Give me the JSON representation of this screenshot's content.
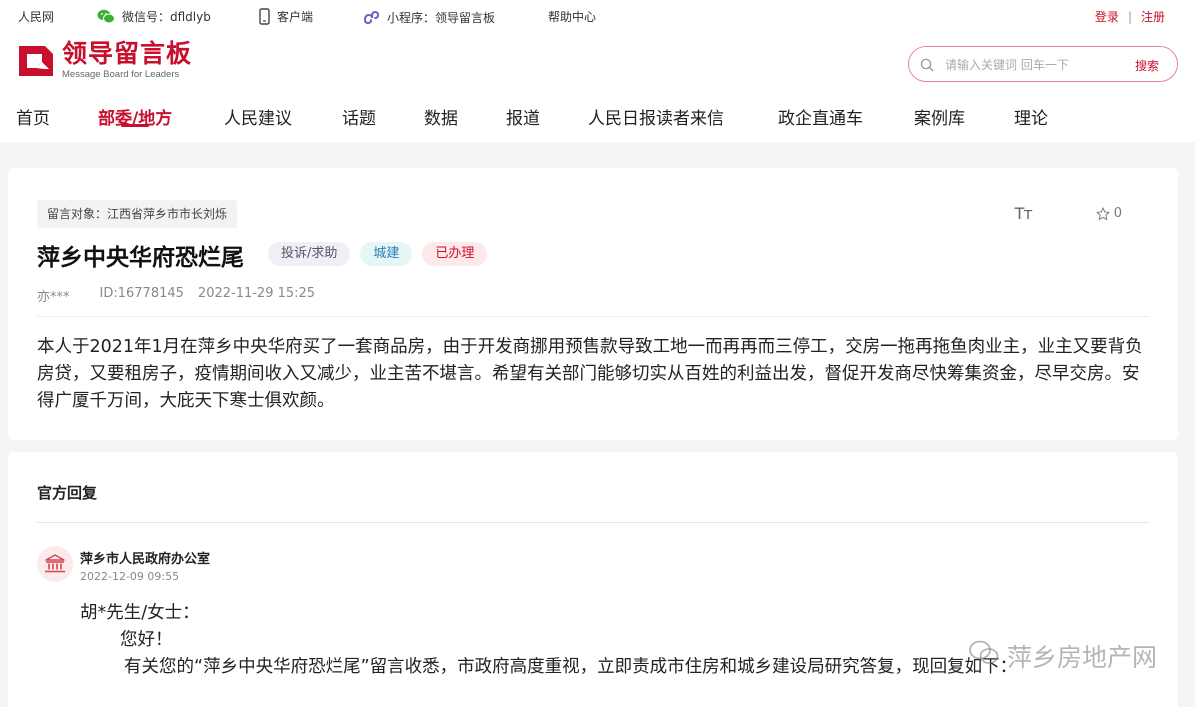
{
  "topbar": {
    "site": "人民网",
    "wechat": "微信号：dfldlyb",
    "client": "客户端",
    "miniprogram": "小程序：领导留言板",
    "help": "帮助中心",
    "login": "登录",
    "separator": "|",
    "register": "注册"
  },
  "logo": {
    "title": "领导留言板",
    "subtitle": "Message Board for Leaders"
  },
  "search": {
    "placeholder": "请输入关键词 回车一下",
    "button": "搜索"
  },
  "nav": [
    {
      "label": "首页",
      "active": false
    },
    {
      "label": "部委/地方",
      "active": true
    },
    {
      "label": "人民建议",
      "active": false
    },
    {
      "label": "话题",
      "active": false
    },
    {
      "label": "数据",
      "active": false
    },
    {
      "label": "报道",
      "active": false
    },
    {
      "label": "人民日报读者来信",
      "active": false
    },
    {
      "label": "政企直通车",
      "active": false
    },
    {
      "label": "案例库",
      "active": false
    },
    {
      "label": "理论",
      "active": false
    }
  ],
  "message": {
    "target": "留言对象：江西省萍乡市市长刘烁",
    "font_icon": "Tт",
    "favorites": "0",
    "title": "萍乡中央华府恐烂尾",
    "tags": [
      "投诉/求助",
      "城建",
      "已办理"
    ],
    "author": "亦***",
    "id": "ID:16778145",
    "datetime": "2022-11-29 15:25",
    "content": "本人于2021年1月在萍乡中央华府买了一套商品房，由于开发商挪用预售款导致工地一而再再而三停工，交房一拖再拖鱼肉业主，业主又要背负房贷，又要租房子，疫情期间收入又减少，业主苦不堪言。希望有关部门能够切实从百姓的利益出发，督促开发商尽快筹集资金，尽早交房。安得广厦千万间，大庇天下寒士俱欢颜。"
  },
  "reply": {
    "heading": "官方回复",
    "org": "萍乡市人民政府办公室",
    "date": "2022-12-09 09:55",
    "salutation": "胡*先生/女士：",
    "greeting": "您好！",
    "body": "有关您的“萍乡中央华府恐烂尾”留言收悉，市政府高度重视，立即责成市住房和城乡建设局研究答复，现回复如下："
  },
  "watermark": "萍乡房地产网",
  "colors": {
    "brand_red": "#c8102e",
    "page_bg": "#f4f5f7"
  },
  "icons": [
    "wechat-icon",
    "phone-icon",
    "miniprogram-icon",
    "search-icon",
    "font-size-icon",
    "star-icon",
    "government-building-icon",
    "watermark-wechat-icon"
  ]
}
